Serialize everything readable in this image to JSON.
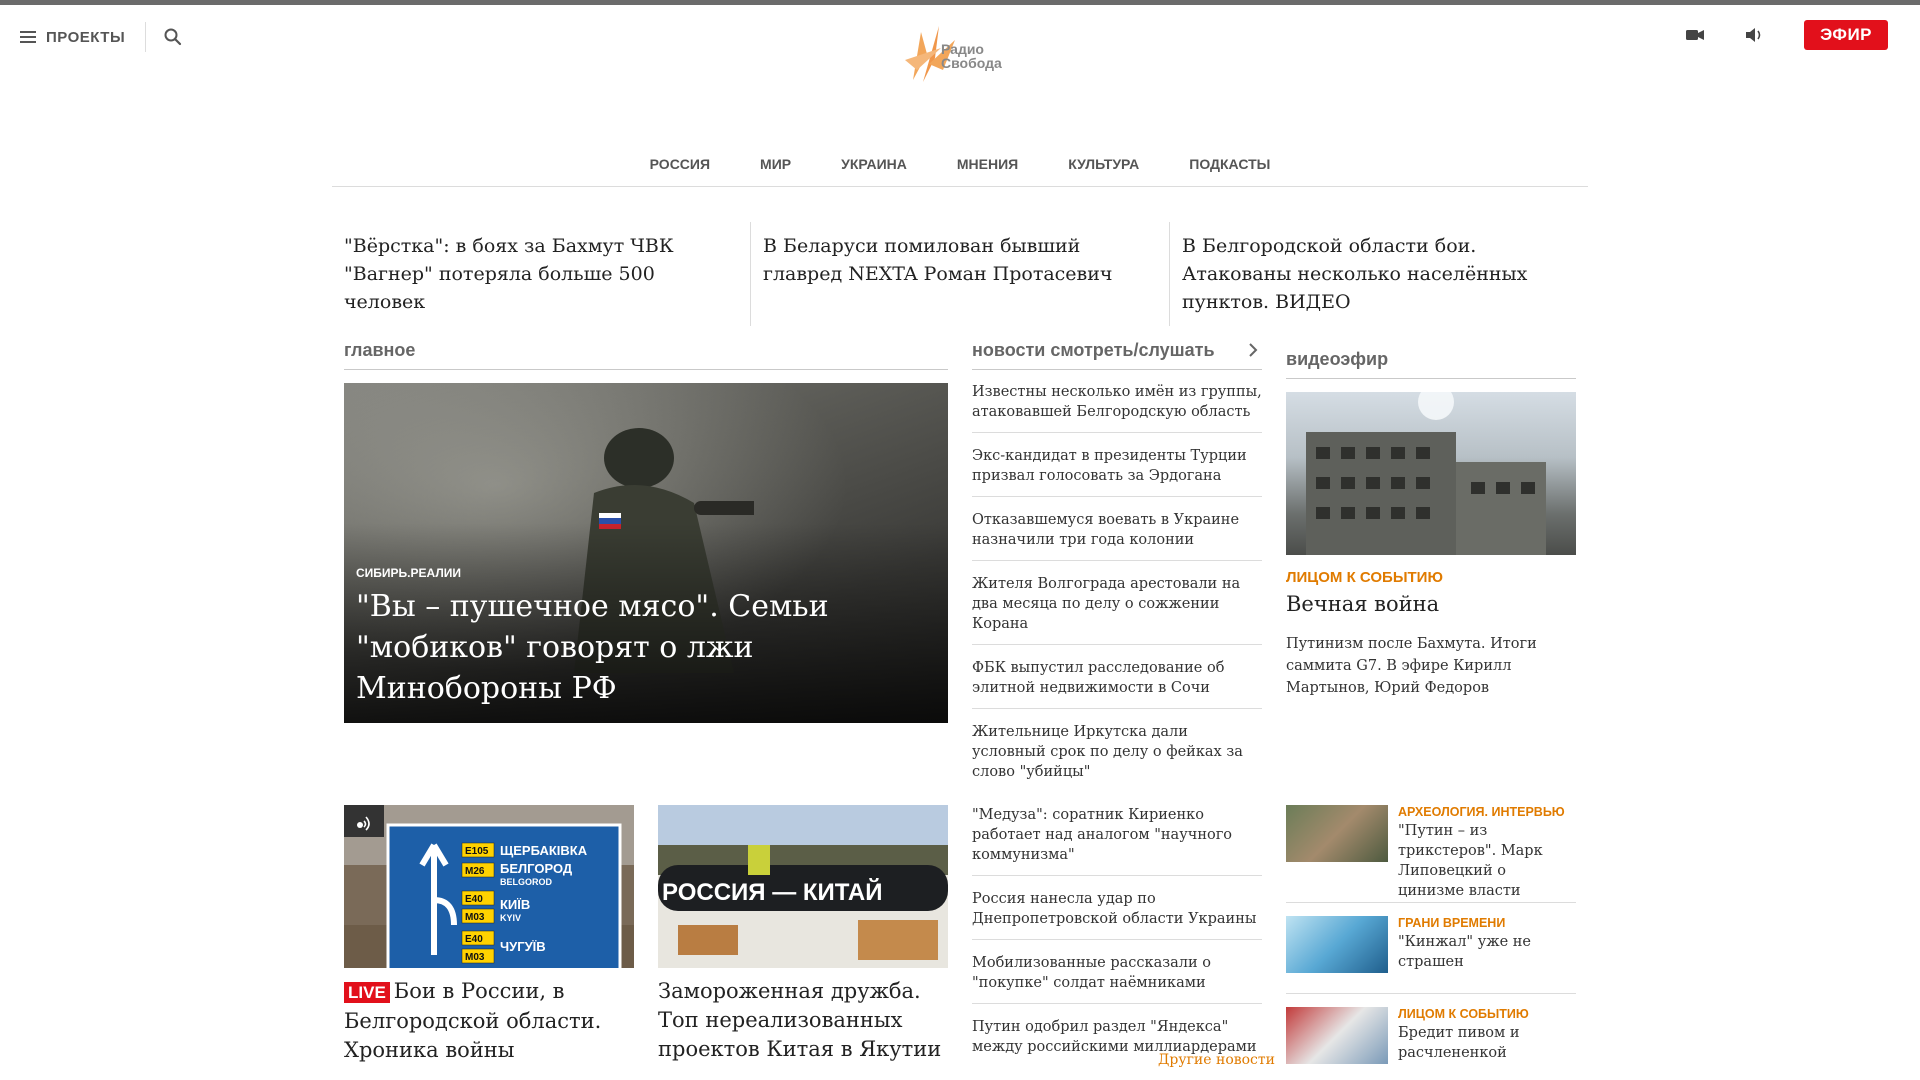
{
  "header": {
    "projects_label": "ПРОЕКТЫ",
    "logo_text_1": "Радио",
    "logo_text_2": "Свобода",
    "efir_label": "ЭФИР"
  },
  "nav": [
    "РОССИЯ",
    "МИР",
    "УКРАИНА",
    "МНЕНИЯ",
    "КУЛЬТУРА",
    "ПОДКАСТЫ"
  ],
  "top_headlines": [
    "\"Вёрстка\": в боях за Бахмут ЧВК \"Вагнер\" потеряла больше 500 человек",
    "В Беларуси помилован бывший главред NEXTA Роман Протасевич",
    "В Белгородской области бои. Атакованы несколько населённых пунктов. ВИДЕО"
  ],
  "main": {
    "heading": "главное",
    "hero_kicker": "СИБИРЬ.РЕАЛИИ",
    "hero_title": "\"Вы – пушечное мясо\". Семьи \"мобиков\" говорят о лжи Минобороны РФ"
  },
  "news": {
    "heading": "новости смотреть/слушать",
    "items": [
      "Известны несколько имён из группы, атаковавшей Белгородскую область",
      "Экс-кандидат в президенты Турции призвал голосовать за Эрдогана",
      "Отказавшемуся воевать в Украине назначили три года колонии",
      "Жителя Волгограда арестовали на два месяца по делу о сожжении Корана",
      "ФБК выпустил расследование об элитной недвижимости в Сочи",
      "Жительнице Иркутска дали условный срок по делу о фейках за слово \"убийцы\""
    ],
    "items2": [
      "\"Медуза\": соратник Кириенко работает над аналогом \"научного коммунизма\"",
      "Россия нанесла удар по Днепропетровской области Украины",
      "Мобилизованные рассказали о \"покупке\" солдат наёмниками",
      "Путин одобрил раздел \"Яндекса\" между российскими миллиардерами"
    ],
    "more_label": "Другие новости"
  },
  "video": {
    "heading": "видеоэфир",
    "kicker": "ЛИЦОМ К СОБЫТИЮ",
    "title": "Вечная война",
    "desc": "Путинизм после Бахмута. Итоги саммита G7. В эфире Кирилл Мартынов, Юрий Федоров"
  },
  "cards": [
    {
      "live": "LIVE",
      "title": "Бои в России, в Белгородской области. Хроника войны"
    },
    {
      "title": "Замороженная дружба. Топ нереализованных проектов Китая в Якутии"
    }
  ],
  "sign": {
    "codes": [
      "E105",
      "M26",
      "E40",
      "M03",
      "E40",
      "M03"
    ],
    "names": [
      "ЩЕРБАКІВКА",
      "БЕЛГОРОД",
      "BELGOROD",
      "КИЇВ",
      "KYIV",
      "ЧУГУЇВ"
    ]
  },
  "pipe_text": "РОССИЯ — КИТАЙ",
  "mini_list": [
    {
      "kicker": "АРХЕОЛОГИЯ. ИНТЕРВЬЮ",
      "text": "\"Путин – из трикстеров\". Марк Липовецкий о цинизме власти"
    },
    {
      "kicker": "ГРАНИ ВРЕМЕНИ",
      "text": "\"Кинжал\" уже не страшен"
    },
    {
      "kicker": "ЛИЦОМ К СОБЫТИЮ",
      "text": "Бредит пивом и расчлененкой"
    }
  ],
  "colors": {
    "accent": "#e07b00",
    "live": "#e2101b",
    "efir": "#e2101b"
  }
}
